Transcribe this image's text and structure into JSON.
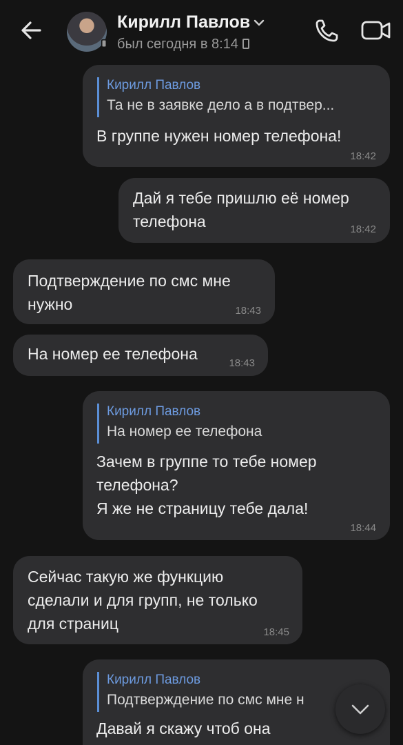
{
  "header": {
    "contact_name": "Кирилл Павлов",
    "status": "был сегодня в 8:14"
  },
  "messages": [
    {
      "direction": "outgoing",
      "reply": {
        "name": "Кирилл Павлов",
        "text": "Та не в заявке дело а в подтвер..."
      },
      "lines": [
        "В группе нужен номер телефона!"
      ],
      "time": "18:42"
    },
    {
      "direction": "outgoing",
      "lines": [
        "Дай я тебе пришлю её номер",
        "телефона"
      ],
      "time": "18:42"
    },
    {
      "direction": "incoming",
      "lines": [
        "Подтверждение по смс мне",
        "нужно"
      ],
      "time": "18:43"
    },
    {
      "direction": "incoming",
      "lines": [
        "На номер ее телефона"
      ],
      "time": "18:43"
    },
    {
      "direction": "outgoing",
      "reply": {
        "name": "Кирилл Павлов",
        "text": "На номер ее телефона"
      },
      "lines": [
        "Зачем в группе то тебе номер",
        "телефона?",
        "Я же не страницу тебе дала!"
      ],
      "time": "18:44"
    },
    {
      "direction": "incoming",
      "lines": [
        "Сейчас такую же функцию",
        "сделали и для групп, не только",
        "для страниц"
      ],
      "time": "18:45"
    },
    {
      "direction": "outgoing",
      "reply": {
        "name": "Кирилл Павлов",
        "text": "Подтверждение по смс мне н"
      },
      "lines": [
        "Давай я скажу чтоб она"
      ],
      "time": ""
    }
  ],
  "icons": {
    "back": "arrow-left-icon",
    "chevron": "chevron-down-icon",
    "call": "phone-icon",
    "video": "video-camera-icon",
    "scroll": "chevron-down-icon"
  },
  "colors": {
    "background": "#141414",
    "bubble": "#2e2e30",
    "reply_accent": "#5b8fd6"
  }
}
